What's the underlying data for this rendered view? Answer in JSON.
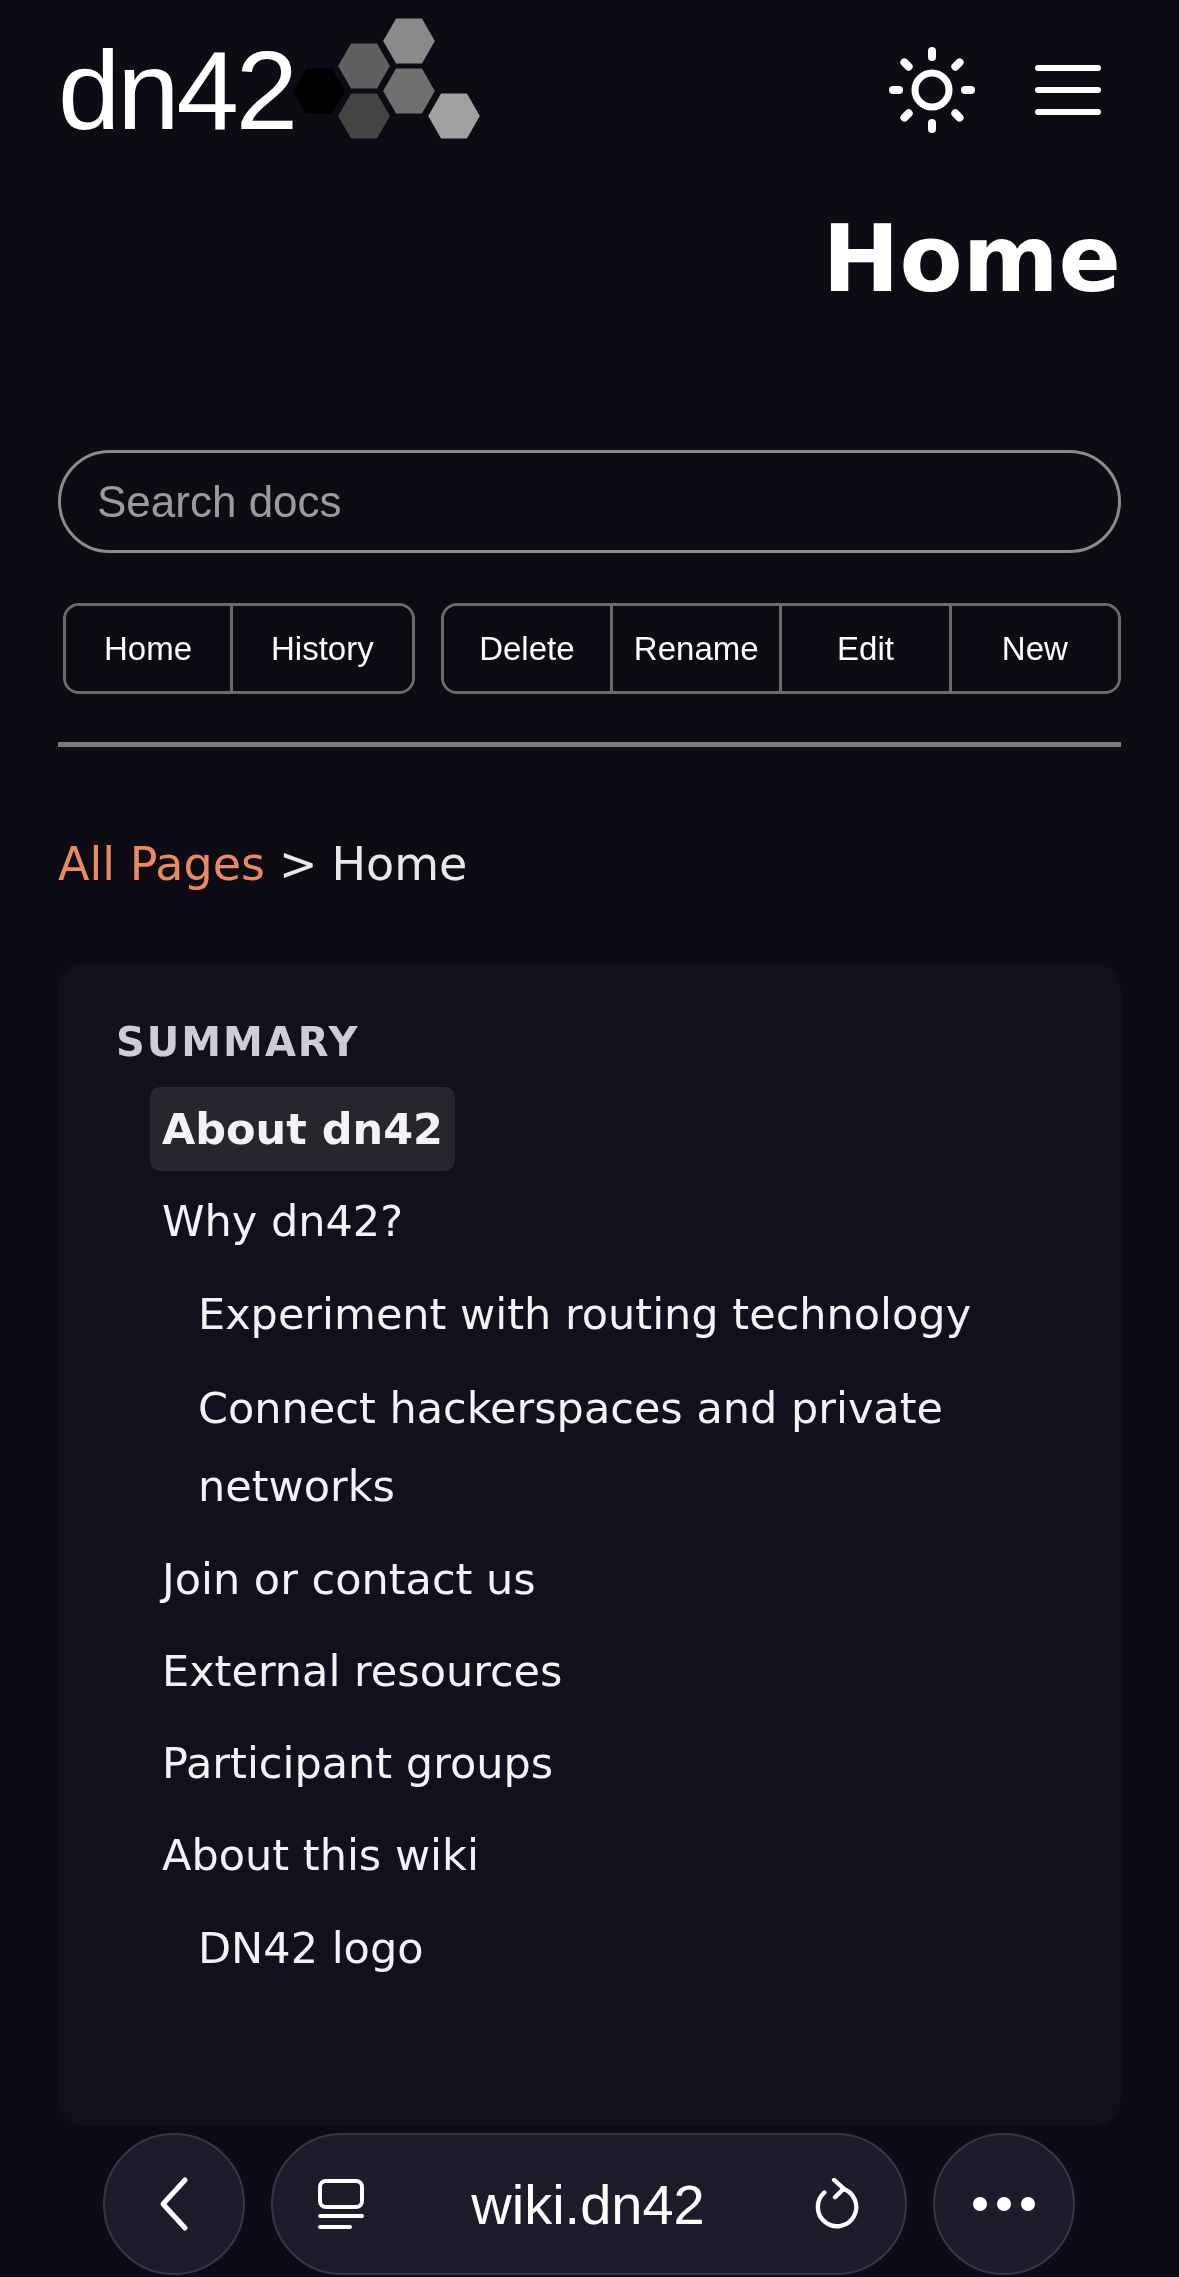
{
  "header": {
    "logo_text": "dn42"
  },
  "page_title": "Home",
  "search": {
    "placeholder": "Search docs"
  },
  "button_groups": [
    {
      "buttons": [
        "Home",
        "History"
      ]
    },
    {
      "buttons": [
        "Delete",
        "Rename",
        "Edit",
        "New"
      ]
    }
  ],
  "breadcrumb": {
    "link": "All Pages",
    "separator": ">",
    "current": "Home"
  },
  "summary": {
    "title": "SUMMARY",
    "items": [
      {
        "label": "About dn42",
        "selected": true
      },
      {
        "label": "Why dn42?",
        "selected": false,
        "children": [
          {
            "label": "Experiment with routing technology",
            "selected": false
          },
          {
            "label": "Connect hackerspaces and private networks",
            "selected": false
          }
        ]
      },
      {
        "label": "Join or contact us",
        "selected": false
      },
      {
        "label": "External resources",
        "selected": false
      },
      {
        "label": "Participant groups",
        "selected": false
      },
      {
        "label": "About this wiki",
        "selected": false,
        "children": [
          {
            "label": "DN42 logo",
            "selected": false
          }
        ]
      }
    ]
  },
  "browser_bar": {
    "url": "wiki.dn42"
  }
}
